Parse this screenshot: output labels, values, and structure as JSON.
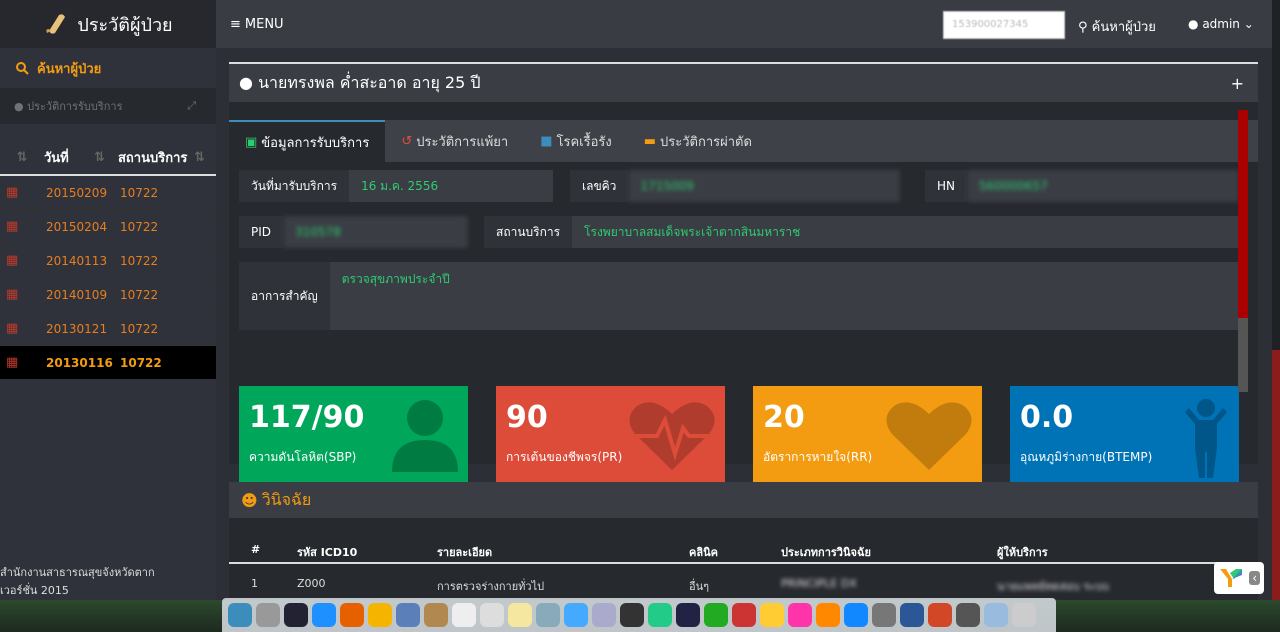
{
  "sidebar": {
    "brand": "ประวัติผู้ป่วย",
    "search_label": "ค้นหาผู้ป่วย",
    "panel_title": "ประวัติการรับบริการ",
    "col_date": "วันที่",
    "col_place": "สถานบริการ",
    "rows": [
      {
        "date": "20150209",
        "place": "10722"
      },
      {
        "date": "20150204",
        "place": "10722"
      },
      {
        "date": "20140113",
        "place": "10722"
      },
      {
        "date": "20140109",
        "place": "10722"
      },
      {
        "date": "20130121",
        "place": "10722"
      },
      {
        "date": "20130116",
        "place": "10722"
      }
    ],
    "footer_line1": "สำนักงานสาธารณสุขจังหวัดตาก",
    "footer_line2": "เวอร์ชั่น 2015"
  },
  "topbar": {
    "menu": "MENU",
    "search_value": "153900027345",
    "search_button": "ค้นหาผู้ป่วย",
    "user": "admin"
  },
  "patient": {
    "header": "นายทรงพล ค่ำสะอาด อายุ 25 ปี",
    "tabs": [
      "ข้อมูลการรับบริการ",
      "ประวัติการแพ้ยา",
      "โรคเรื้อรัง",
      "ประวัติการผ่าตัด"
    ],
    "visit_date_label": "วันที่มารับบริการ",
    "visit_date": "16 ม.ค. 2556",
    "queue_label": "เลขคิว",
    "queue": "1715009",
    "hn_label": "HN",
    "hn": "560000657",
    "pid_label": "PID",
    "pid": "310578",
    "place_label": "สถานบริการ",
    "place": "โรงพยาบาลสมเด็จพระเจ้าตากสินมหาราช",
    "symptom_label": "อาการสำคัญ",
    "symptom": "ตรวจสุขภาพประจำปี"
  },
  "vitals": [
    {
      "value": "117/90",
      "caption": "ความดันโลหิต(SBP)",
      "color": "#00a65a",
      "icon": "user-icon"
    },
    {
      "value": "90",
      "caption": "การเต้นของชีพจร(PR)",
      "color": "#dd4b39",
      "icon": "heartbeat-icon"
    },
    {
      "value": "20",
      "caption": "อัตราการหายใจ(RR)",
      "color": "#f39c12",
      "icon": "heart-icon"
    },
    {
      "value": "0.0",
      "caption": "อุณหภูมิร่างกาย(BTEMP)",
      "color": "#0073b7",
      "icon": "child-icon"
    }
  ],
  "diagnosis": {
    "title": "วินิจฉัย",
    "headers": [
      "#",
      "รหัส ICD10",
      "รายละเอียด",
      "คลินิค",
      "ประเภทการวินิจฉัย",
      "ผู้ให้บริการ"
    ],
    "rows": [
      [
        "1",
        "Z000",
        "การตรวจร่างกายทั่วไป",
        "อื่นๆ",
        "PRINCIPLE DX",
        "นายแพทย์ทดสอบ ระบบ"
      ]
    ]
  }
}
